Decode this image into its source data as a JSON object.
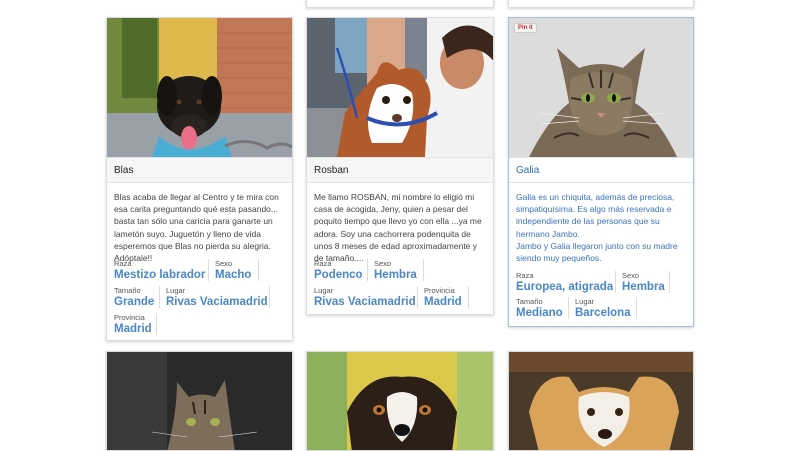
{
  "cards": [
    {
      "name": "Blas",
      "description": "Blas acaba de llegar al Centro y te mira con esa carita preguntando qué esta pasando... basta tan sólo una caricia para ganarte un lametón suyo. Juguetón y lleno de vida esperemos que Blas no pierda su alegria. Adóptale!!",
      "raza_label": "Raza",
      "raza": "Mestizo labrador",
      "sexo_label": "Sexo",
      "sexo": "Macho",
      "tamano_label": "Tamaño",
      "tamano": "Grande",
      "lugar_label": "Lugar",
      "lugar": "Rivas Vaciamadrid",
      "provincia_label": "Provincia",
      "provincia": "Madrid"
    },
    {
      "name": "Rosban",
      "description": "Me llamo ROSBAN, mi nombre lo eligió mi casa de acogida, Jeny, quien a pesar del poquito tiempo que llevo yo con ella ...ya me adora. Soy una cachorrera podenquita de unos 8 meses de edad aproximadamente y de tamaño....",
      "raza_label": "Raza",
      "raza": "Podenco",
      "sexo_label": "Sexo",
      "sexo": "Hembra",
      "lugar_label": "Lugar",
      "lugar": "Rivas Vaciamadrid",
      "provincia_label": "Provincia",
      "provincia": "Madrid"
    },
    {
      "name": "Galia",
      "description": "Galia es un chiquita, además de preciosa, simpatiquísima. Es algo más reservada e independiente de las personas que su hermano Jambo.\nJambo y Galia llegaron junto con su madre siendo muy pequeños.",
      "raza_label": "Raza",
      "raza": "Europea, atigrada",
      "sexo_label": "Sexo",
      "sexo": "Hembra",
      "tamano_label": "Tamaño",
      "tamano": "Mediano",
      "lugar_label": "Lugar",
      "lugar": "Barcelona",
      "pin_label": "Pin it"
    }
  ],
  "icons": [
    "pinterest-pin-icon"
  ],
  "colors": {
    "link_blue": "#4a87c7",
    "selected_text": "#3c72c0"
  }
}
